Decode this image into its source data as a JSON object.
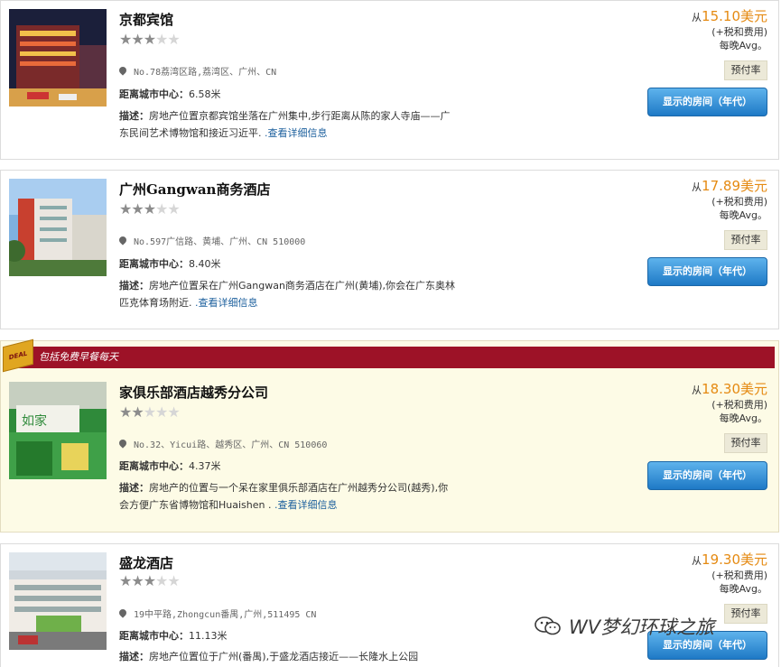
{
  "hotels": [
    {
      "name": "京都宾馆",
      "stars": 3,
      "address": "No.78荔湾区路,荔湾区、广州、CN",
      "distance_label": "距离城市中心：",
      "distance": "6.58米",
      "desc_label": "描述：",
      "desc": "房地产位置京都宾馆坐落在广州集中,步行距离从陈的家人寺庙——广东民间艺术博物馆和接近习近平.",
      "more": " .查看详细信息",
      "price_from": "从",
      "price": "15.10美元",
      "tax": "(+税和费用)",
      "avg": "每晚Avg。",
      "rate_btn": "预付率",
      "show_btn": "显示的房间（年代）"
    },
    {
      "name": "广州Gangwan商务酒店",
      "stars": 3,
      "address": "No.597广信路、黄埔、广州、CN 510000",
      "distance_label": "距离城市中心：",
      "distance": "8.40米",
      "desc_label": "描述：",
      "desc": "房地产位置呆在广州Gangwan商务酒店在广州(黄埔),你会在广东奥林匹克体育场附近.",
      "more": " .查看详细信息",
      "price_from": "从",
      "price": "17.89美元",
      "tax": "(+税和费用)",
      "avg": "每晚Avg。",
      "rate_btn": "预付率",
      "show_btn": "显示的房间（年代）"
    },
    {
      "deal_text": "包括免费早餐每天",
      "deal_tag": "DEAL",
      "name": "家俱乐部酒店越秀分公司",
      "stars": 2,
      "address": "No.32、Yicui路、越秀区、广州、CN 510060",
      "distance_label": "距离城市中心：",
      "distance": "4.37米",
      "desc_label": "描述：",
      "desc": "房地产的位置与一个呆在家里俱乐部酒店在广州越秀分公司(越秀),你会方便广东省博物馆和Huaishen .",
      "more": " .查看详细信息",
      "price_from": "从",
      "price": "18.30美元",
      "tax": "(+税和费用)",
      "avg": "每晚Avg。",
      "rate_btn": "预付率",
      "show_btn": "显示的房间（年代）"
    },
    {
      "name": "盛龙酒店",
      "stars": 3,
      "address": "19中平路,Zhongcun番禺,广州,511495 CN",
      "distance_label": "距离城市中心：",
      "distance": "11.13米",
      "desc_label": "描述：",
      "desc": "房地产位置位于广州(番禺),于盛龙酒店接近——长隆水上公园",
      "price_from": "从",
      "price": "19.30美元",
      "tax": "(+税和费用)",
      "avg": "每晚Avg。",
      "rate_btn": "预付率",
      "show_btn": "显示的房间（年代）"
    }
  ],
  "watermark": "WV梦幻环球之旅",
  "colors": {
    "price": "#e58a12",
    "deal_banner": "#9d1227",
    "button": "#1e79c6",
    "link": "#1a5e9c"
  }
}
